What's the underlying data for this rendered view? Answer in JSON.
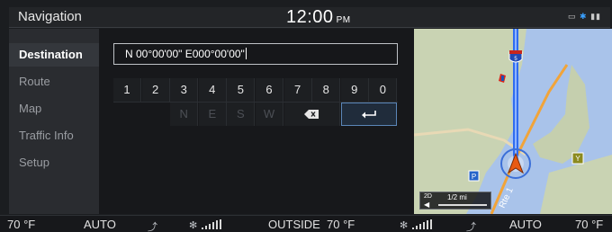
{
  "status_bar": {
    "title": "Navigation",
    "time": "12:00",
    "ampm": "PM",
    "icons": [
      "battery-icon",
      "bluetooth-icon",
      "signal-icon"
    ]
  },
  "sidebar": {
    "items": [
      {
        "label": "Destination",
        "active": true
      },
      {
        "label": "Route",
        "active": false
      },
      {
        "label": "Map",
        "active": false
      },
      {
        "label": "Traffic Info",
        "active": false
      },
      {
        "label": "Setup",
        "active": false
      }
    ]
  },
  "coordinate_entry": {
    "value": "N 00°00'00\" E000°00'00\""
  },
  "keypad": {
    "digits": [
      "1",
      "2",
      "3",
      "4",
      "5",
      "6",
      "7",
      "8",
      "9",
      "0"
    ],
    "directions": [
      "N",
      "E",
      "S",
      "W"
    ],
    "backspace_icon": "backspace-icon",
    "enter_icon": "enter-icon"
  },
  "map": {
    "scale": "1/2 mi",
    "view_mode": "2D",
    "road_label": "Rte 1",
    "highway_shield": "5"
  },
  "climate": {
    "left_temp": "70 °F",
    "left_mode": "AUTO",
    "outside_label": "OUTSIDE",
    "outside_temp": "70 °F",
    "right_mode": "AUTO",
    "right_temp": "70 °F"
  },
  "colors": {
    "background": "#1b1d20",
    "accent": "#5b86b8",
    "route": "#2f6cf0",
    "water": "#a9c3ea",
    "land": "#c9d3b3"
  }
}
